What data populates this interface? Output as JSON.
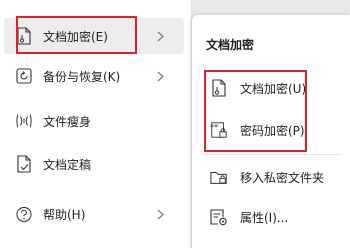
{
  "main_menu": {
    "items": [
      {
        "label": "文档加密(E)",
        "icon": "document-lock-icon",
        "has_submenu": true
      },
      {
        "label": "备份与恢复(K)",
        "icon": "backup-restore-icon",
        "has_submenu": true
      },
      {
        "label": "文件瘦身",
        "icon": "file-slim-icon",
        "has_submenu": false
      },
      {
        "label": "文档定稿",
        "icon": "document-finalize-icon",
        "has_submenu": false
      },
      {
        "label": "帮助(H)",
        "icon": "help-icon",
        "has_submenu": true
      }
    ]
  },
  "sub_menu": {
    "title": "文档加密",
    "items": [
      {
        "label": "文档加密(U)",
        "icon": "document-lock-icon"
      },
      {
        "label": "密码加密(P)",
        "icon": "password-lock-icon"
      },
      {
        "label": "移入私密文件夹",
        "icon": "private-folder-icon"
      },
      {
        "label": "属性(I)...",
        "icon": "properties-icon"
      }
    ]
  },
  "colors": {
    "highlight": "#e0212b",
    "hover_bg": "#ededed"
  }
}
